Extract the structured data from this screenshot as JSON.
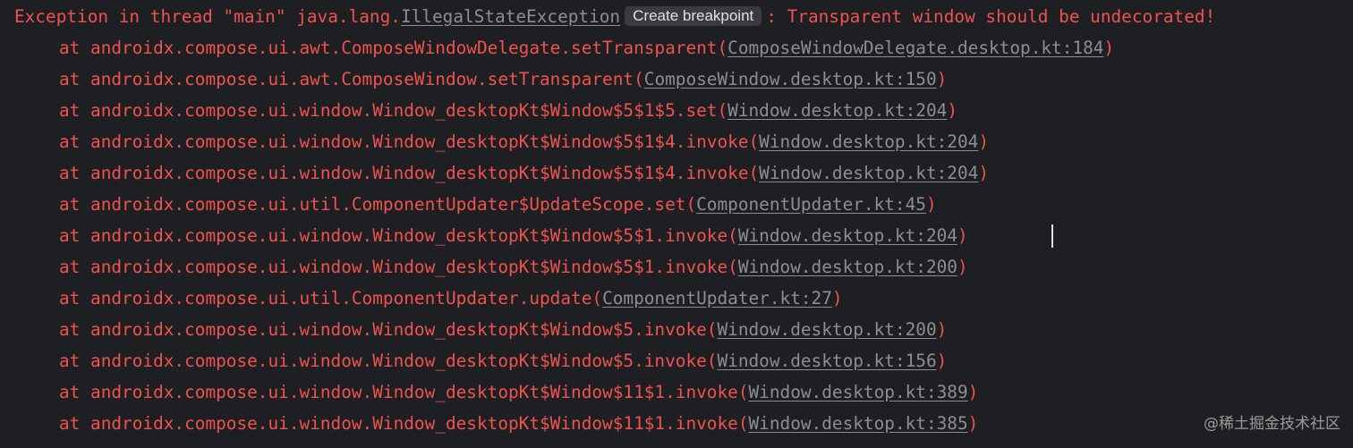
{
  "colors": {
    "background": "#1e1f22",
    "error_text": "#f0524f",
    "link_text": "#8c8e94",
    "chip_background": "#393b40",
    "chip_text": "#dfe1e5"
  },
  "exception": {
    "prefix": "Exception in thread \"main\" java.lang.",
    "exception_class": "IllegalStateException",
    "breakpoint_chip": "Create breakpoint",
    "message": ": Transparent window should be undecorated!"
  },
  "stack_frames": [
    {
      "method": "at androidx.compose.ui.awt.ComposeWindowDelegate.setTransparent(",
      "location": "ComposeWindowDelegate.desktop.kt:184",
      "close": ")"
    },
    {
      "method": "at androidx.compose.ui.awt.ComposeWindow.setTransparent(",
      "location": "ComposeWindow.desktop.kt:150",
      "close": ")"
    },
    {
      "method": "at androidx.compose.ui.window.Window_desktopKt$Window$5$1$5.set(",
      "location": "Window.desktop.kt:204",
      "close": ")"
    },
    {
      "method": "at androidx.compose.ui.window.Window_desktopKt$Window$5$1$4.invoke(",
      "location": "Window.desktop.kt:204",
      "close": ")"
    },
    {
      "method": "at androidx.compose.ui.window.Window_desktopKt$Window$5$1$4.invoke(",
      "location": "Window.desktop.kt:204",
      "close": ")"
    },
    {
      "method": "at androidx.compose.ui.util.ComponentUpdater$UpdateScope.set(",
      "location": "ComponentUpdater.kt:45",
      "close": ")"
    },
    {
      "method": "at androidx.compose.ui.window.Window_desktopKt$Window$5$1.invoke(",
      "location": "Window.desktop.kt:204",
      "close": ")"
    },
    {
      "method": "at androidx.compose.ui.window.Window_desktopKt$Window$5$1.invoke(",
      "location": "Window.desktop.kt:200",
      "close": ")"
    },
    {
      "method": "at androidx.compose.ui.util.ComponentUpdater.update(",
      "location": "ComponentUpdater.kt:27",
      "close": ")"
    },
    {
      "method": "at androidx.compose.ui.window.Window_desktopKt$Window$5.invoke(",
      "location": "Window.desktop.kt:200",
      "close": ")"
    },
    {
      "method": "at androidx.compose.ui.window.Window_desktopKt$Window$5.invoke(",
      "location": "Window.desktop.kt:156",
      "close": ")"
    },
    {
      "method": "at androidx.compose.ui.window.Window_desktopKt$Window$11$1.invoke(",
      "location": "Window.desktop.kt:389",
      "close": ")"
    },
    {
      "method": "at androidx.compose.ui.window.Window_desktopKt$Window$11$1.invoke(",
      "location": "Window.desktop.kt:385",
      "close": ")"
    }
  ],
  "watermark": "@稀土掘金技术社区"
}
